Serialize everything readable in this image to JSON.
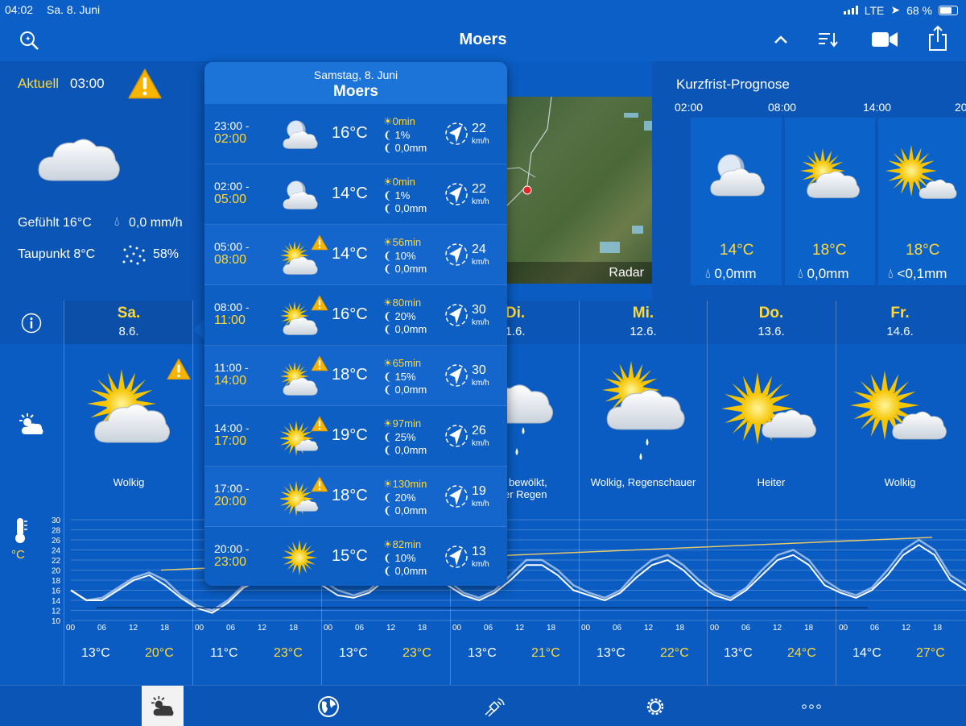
{
  "status": {
    "time": "04:02",
    "date": "Sa. 8. Juni",
    "network": "LTE",
    "battery": "68 %"
  },
  "nav": {
    "title": "Moers"
  },
  "current": {
    "label": "Aktuell",
    "time": "03:00",
    "feels": "Gefühlt 16°C",
    "precip": "0,0 mm/h",
    "dewpoint": "Taupunkt 8°C",
    "humidity": "58%"
  },
  "radar": {
    "label": "Radar"
  },
  "short_term": {
    "title": "Kurzfrist-Prognose",
    "times": [
      "02:00",
      "08:00",
      "14:00",
      "20"
    ],
    "temps": [
      "14°C",
      "18°C",
      "18°C"
    ],
    "precip": [
      "0,0mm",
      "0,0mm",
      "<0,1mm"
    ]
  },
  "days": [
    {
      "name": "Sa.",
      "date": "8.6.",
      "desc": "Wolkig",
      "low": "13°C",
      "high": "20°C"
    },
    {
      "name": "",
      "date": "",
      "desc": "",
      "low": "11°C",
      "high": "23°C"
    },
    {
      "name": "",
      "date": "",
      "desc": "",
      "low": "13°C",
      "high": "23°C"
    },
    {
      "name": "Di.",
      "date": "1.6.",
      "desc": "bewölkt,",
      "desc2": "er Regen",
      "low": "13°C",
      "high": "21°C"
    },
    {
      "name": "Mi.",
      "date": "12.6.",
      "desc": "Wolkig, Regenschauer",
      "low": "13°C",
      "high": "22°C"
    },
    {
      "name": "Do.",
      "date": "13.6.",
      "desc": "Heiter",
      "low": "13°C",
      "high": "24°C"
    },
    {
      "name": "Fr.",
      "date": "14.6.",
      "desc": "Wolkig",
      "low": "14°C",
      "high": "27°C"
    }
  ],
  "chart_data": {
    "type": "line",
    "ylabel": "°C",
    "ylim": [
      10,
      30
    ],
    "yticks": [
      "30",
      "28",
      "26",
      "24",
      "22",
      "20",
      "18",
      "16",
      "14",
      "12",
      "10"
    ],
    "xticks": [
      "00",
      "06",
      "12",
      "18"
    ],
    "series": [
      {
        "values": [
          16,
          14,
          14.5,
          16.5,
          18.5,
          19.5,
          18,
          15,
          13,
          12,
          14,
          17,
          19,
          21,
          22,
          21,
          18,
          16,
          15,
          16,
          19,
          21.5,
          22,
          21,
          18,
          15.5,
          14.5,
          16,
          19,
          22,
          22,
          20,
          17,
          15.5,
          14.5,
          16,
          19.5,
          22,
          23,
          21,
          18,
          15.5,
          14.5,
          16.5,
          20,
          23,
          24,
          22,
          18,
          16,
          15,
          16.5,
          20,
          24,
          26,
          24,
          19,
          17
        ]
      },
      {
        "values": [
          16,
          14,
          14,
          16,
          18,
          19,
          17,
          14.5,
          12.5,
          11.5,
          13.5,
          16.5,
          18,
          20,
          21,
          20,
          17,
          15,
          14.5,
          15.5,
          18,
          20.5,
          21,
          20,
          17,
          15,
          14,
          15.5,
          18,
          21,
          21,
          19,
          16,
          15,
          14,
          15.5,
          18.5,
          21,
          22,
          20,
          17,
          15,
          14,
          16,
          19,
          22,
          23,
          21,
          17,
          15.5,
          14.5,
          16,
          19,
          23,
          25,
          23,
          18,
          16
        ]
      }
    ]
  },
  "popup": {
    "date": "Samstag, 8. Juni",
    "city": "Moers",
    "rows": [
      {
        "from": "23:00 -",
        "to": "02:00",
        "temp": "16°C",
        "sun": "0min",
        "rainp": "1%",
        "rainmm": "0,0mm",
        "wind": "22",
        "unit": "km/h",
        "icon": "moon-cloud",
        "warn": false
      },
      {
        "from": "02:00 -",
        "to": "05:00",
        "temp": "14°C",
        "sun": "0min",
        "rainp": "1%",
        "rainmm": "0,0mm",
        "wind": "22",
        "unit": "km/h",
        "icon": "moon-cloud",
        "warn": false
      },
      {
        "from": "05:00 -",
        "to": "08:00",
        "temp": "14°C",
        "sun": "56min",
        "rainp": "10%",
        "rainmm": "0,0mm",
        "wind": "24",
        "unit": "km/h",
        "icon": "sun-cloud",
        "warn": true
      },
      {
        "from": "08:00 -",
        "to": "11:00",
        "temp": "16°C",
        "sun": "80min",
        "rainp": "20%",
        "rainmm": "0,0mm",
        "wind": "30",
        "unit": "km/h",
        "icon": "sun-cloud",
        "warn": true
      },
      {
        "from": "11:00 -",
        "to": "14:00",
        "temp": "18°C",
        "sun": "65min",
        "rainp": "15%",
        "rainmm": "0,0mm",
        "wind": "30",
        "unit": "km/h",
        "icon": "sun-cloud",
        "warn": true
      },
      {
        "from": "14:00 -",
        "to": "17:00",
        "temp": "19°C",
        "sun": "97min",
        "rainp": "25%",
        "rainmm": "0,0mm",
        "wind": "26",
        "unit": "km/h",
        "icon": "sun-small-cloud",
        "warn": true
      },
      {
        "from": "17:00 -",
        "to": "20:00",
        "temp": "18°C",
        "sun": "130min",
        "rainp": "20%",
        "rainmm": "0,0mm",
        "wind": "19",
        "unit": "km/h",
        "icon": "sun-small-cloud",
        "warn": true
      },
      {
        "from": "20:00 -",
        "to": "23:00",
        "temp": "15°C",
        "sun": "82min",
        "rainp": "10%",
        "rainmm": "0,0mm",
        "wind": "13",
        "unit": "km/h",
        "icon": "sun",
        "warn": false
      }
    ]
  }
}
